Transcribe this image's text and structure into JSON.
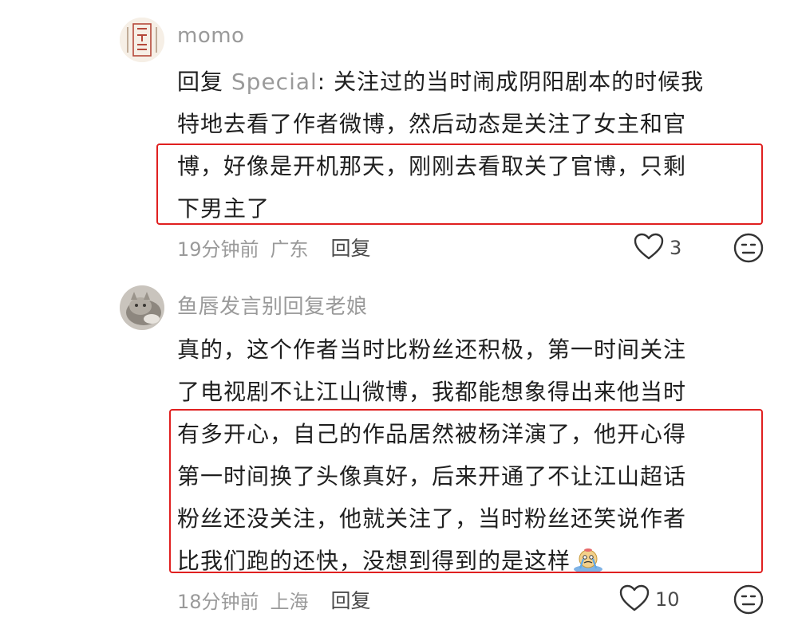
{
  "comments": [
    {
      "username": "momo",
      "reply_prefix": "回复 ",
      "reply_target": "Special",
      "reply_colon": ": ",
      "lines": [
        "关注过的当时闹成阴阳剧本的时候我",
        "特地去看了作者微博，然后动态是关注了女主和官",
        "博，好像是开机那天，刚刚去看取关了官博，只剩",
        "下男主了"
      ],
      "time": "19分钟前",
      "location": "广东",
      "reply_label": "回复",
      "likes": "3",
      "avatar_icon": "seal-avatar-icon"
    },
    {
      "username": "鱼唇发言别回复老娘",
      "lines": [
        "真的，这个作者当时比粉丝还积极，第一时间关注",
        "了电视剧不让江山微博，我都能想象得出来他当时",
        "有多开心，自己的作品居然被杨洋演了，他开心得",
        "第一时间换了头像真好，后来开通了不让江山超话",
        "粉丝还没关注，他就关注了，当时粉丝还笑说作者",
        "比我们跑的还快，没想到得到的是这样"
      ],
      "time": "18分钟前",
      "location": "上海",
      "reply_label": "回复",
      "likes": "10",
      "avatar_icon": "cat-photo-avatar-icon",
      "trailing_emoji": "crying-emoji-icon"
    }
  ],
  "colors": {
    "highlight": "#e02020",
    "muted": "#9a9a9a",
    "text": "#1f1f1f"
  }
}
